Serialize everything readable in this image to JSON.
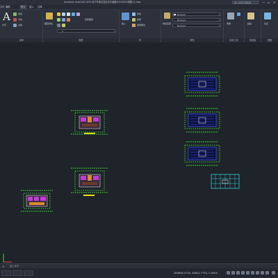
{
  "titlebar": {
    "title": "Autodesk AutoCAD 2020   地下车库住宅区总平面图20200816调整(1).dwg",
    "search_placeholder": "键入关键字或短语"
  },
  "menubar": {
    "items": [
      "文件",
      "编辑",
      "视图",
      "插入",
      "格式",
      "工具",
      "绘图",
      "标注",
      "修改",
      "参数",
      "窗口",
      "帮助"
    ],
    "active_tab": "默认",
    "tabs": [
      "默认",
      "插入",
      "注释",
      "参数化",
      "视图",
      "管理",
      "输出",
      "附加模块",
      "协作",
      "精选应用"
    ]
  },
  "ribbon": {
    "text_label": "文字",
    "panels": [
      "注释",
      "图层",
      "块",
      "特性",
      "实用工具",
      "剪贴板",
      "视图"
    ],
    "small_labels": {
      "linear": "线性",
      "leader": "引线",
      "table": "表格",
      "layer_props": "图层特性",
      "match_layer": "匹配图层",
      "insert": "插入",
      "create": "创建",
      "edit": "编辑",
      "edit_attr": "编辑属性",
      "match_props": "特性匹配",
      "measure": "测量",
      "paste": "粘贴",
      "group": "组",
      "base": "基点"
    },
    "props": [
      "ByLayer",
      "ByLayer",
      "ByLayer"
    ]
  },
  "commandline": {
    "placeholder": "键入命令"
  },
  "statusbar": {
    "coords": "265608.4734, 40812.7752, 0.0000",
    "model_label": "模型"
  },
  "colors": {
    "grass": "#39d33a",
    "building_blue": "#3a4dff",
    "hatch_magenta": "#c23bd6",
    "cyan_plan": "#2fd3d8",
    "yellow_label": "#f2e600",
    "canvas_bg": "#1f232a"
  }
}
